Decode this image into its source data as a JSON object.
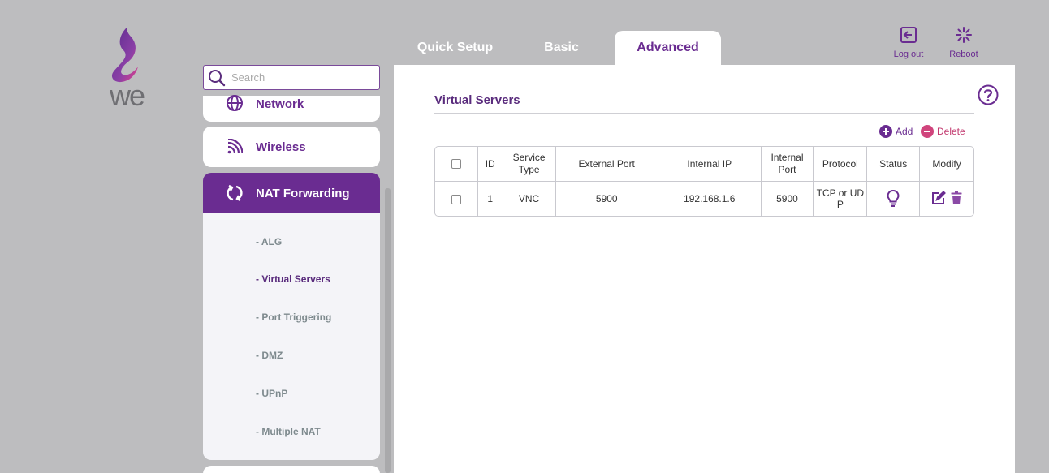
{
  "header": {
    "tabs": [
      {
        "label": "Quick Setup",
        "active": false
      },
      {
        "label": "Basic",
        "active": false
      },
      {
        "label": "Advanced",
        "active": true
      }
    ],
    "logout_label": "Log out",
    "reboot_label": "Reboot",
    "brand_color": "#6a2c91"
  },
  "sidebar": {
    "search_placeholder": "Search",
    "items": [
      {
        "label": "Network",
        "icon": "globe-icon"
      },
      {
        "label": "Wireless",
        "icon": "wifi-icon"
      },
      {
        "label": "NAT Forwarding",
        "icon": "nat-cycle-icon",
        "active": true
      }
    ],
    "submenu": [
      {
        "label": "- ALG"
      },
      {
        "label": "- Virtual Servers",
        "active": true
      },
      {
        "label": "- Port Triggering"
      },
      {
        "label": "- DMZ"
      },
      {
        "label": "- UPnP"
      },
      {
        "label": "- Multiple NAT"
      }
    ]
  },
  "main": {
    "title": "Virtual Servers",
    "add_label": "Add",
    "delete_label": "Delete",
    "table": {
      "headers": [
        "ID",
        "Service Type",
        "External Port",
        "Internal IP",
        "Internal Port",
        "Protocol",
        "Status",
        "Modify"
      ],
      "rows": [
        {
          "id": "1",
          "service_type": "VNC",
          "external_port": "5900",
          "internal_ip": "192.168.1.6",
          "internal_port": "5900",
          "protocol": "TCP or UDP",
          "status": "enabled"
        }
      ]
    }
  }
}
